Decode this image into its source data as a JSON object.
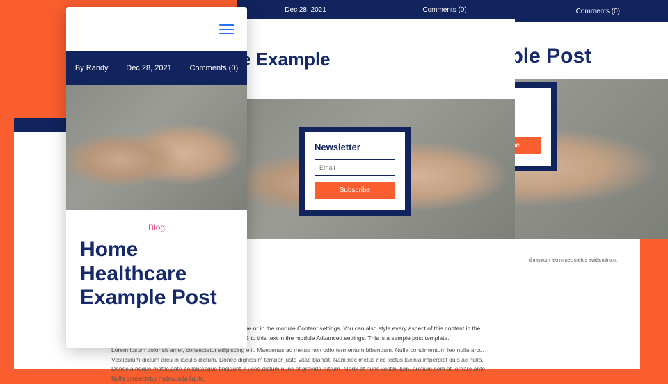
{
  "meta": {
    "author_label": "By Randy",
    "date": "Dec 28, 2021",
    "comments": "Comments (0)"
  },
  "category": "Blog",
  "post_title": "Home Healthcare Example Post",
  "partial_title": "e Example",
  "newsletter": {
    "heading": "Newsletter",
    "placeholder": "Email",
    "button": "Subscribe"
  },
  "body": {
    "lead": "Your content goes here. Edit or remove this text inline or in the module Content settings. You can also style every aspect of this content in the module Design settings and even apply custom CSS to this text in the module Advanced settings. This is a sample post template.",
    "para": "Lorem ipsum dolor sit amet, consectetur adipiscing elit. Maecenas ac metus non odio fermentum bibendum. Nulla condimentum leo nulla arcu. Vestibulum dictum arcu in iaculis dictum. Donec dignissim tempor justo vitae blandit. Nam nec metus nec lectus lacinia imperdiet quis ac nulla. Donec a neque mattis ante pellentesque tincidunt. Fusce dictum nunc et gravida rutrum. Morbi at nunc vestibulum, pretium sem at, ornare ante. Nulla consectetur malesuada ligula."
  },
  "snippet": "dimentum leo m nec metus avida rutrum."
}
